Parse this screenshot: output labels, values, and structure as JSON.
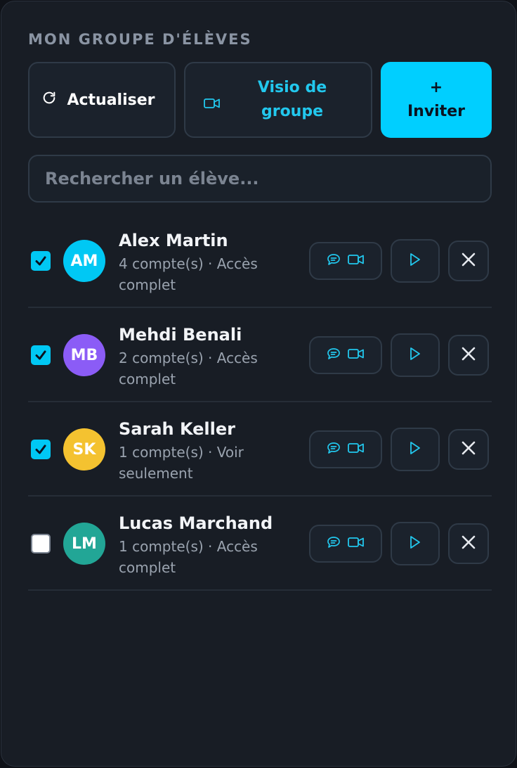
{
  "panel": {
    "title": "MON GROUPE D'ÉLÈVES",
    "refresh_label": "Actualiser",
    "visio_label_line1": "Visio de",
    "visio_label_line2": "groupe",
    "invite_plus": "+",
    "invite_label": "Inviter",
    "search_placeholder": "Rechercher un élève..."
  },
  "colors": {
    "accent": "#00cfff",
    "background": "#181d25"
  },
  "icons": {
    "refresh": "refresh-icon",
    "video": "video-camera-icon",
    "chat": "chat-bubble-icon",
    "play": "play-icon",
    "remove": "close-icon"
  },
  "students": [
    {
      "initials": "AM",
      "name": "Alex Martin",
      "meta": "4 compte(s) · Accès complet",
      "checked": true,
      "avatar_color": "#00c8f4"
    },
    {
      "initials": "MB",
      "name": "Mehdi Benali",
      "meta": "2 compte(s) · Accès complet",
      "checked": true,
      "avatar_color": "#8b5cf6"
    },
    {
      "initials": "SK",
      "name": "Sarah Keller",
      "meta": "1 compte(s) · Voir seulement",
      "checked": true,
      "avatar_color": "#f4c230"
    },
    {
      "initials": "LM",
      "name": "Lucas Marchand",
      "meta": "1 compte(s) · Accès complet",
      "checked": false,
      "avatar_color": "#22a696"
    }
  ]
}
